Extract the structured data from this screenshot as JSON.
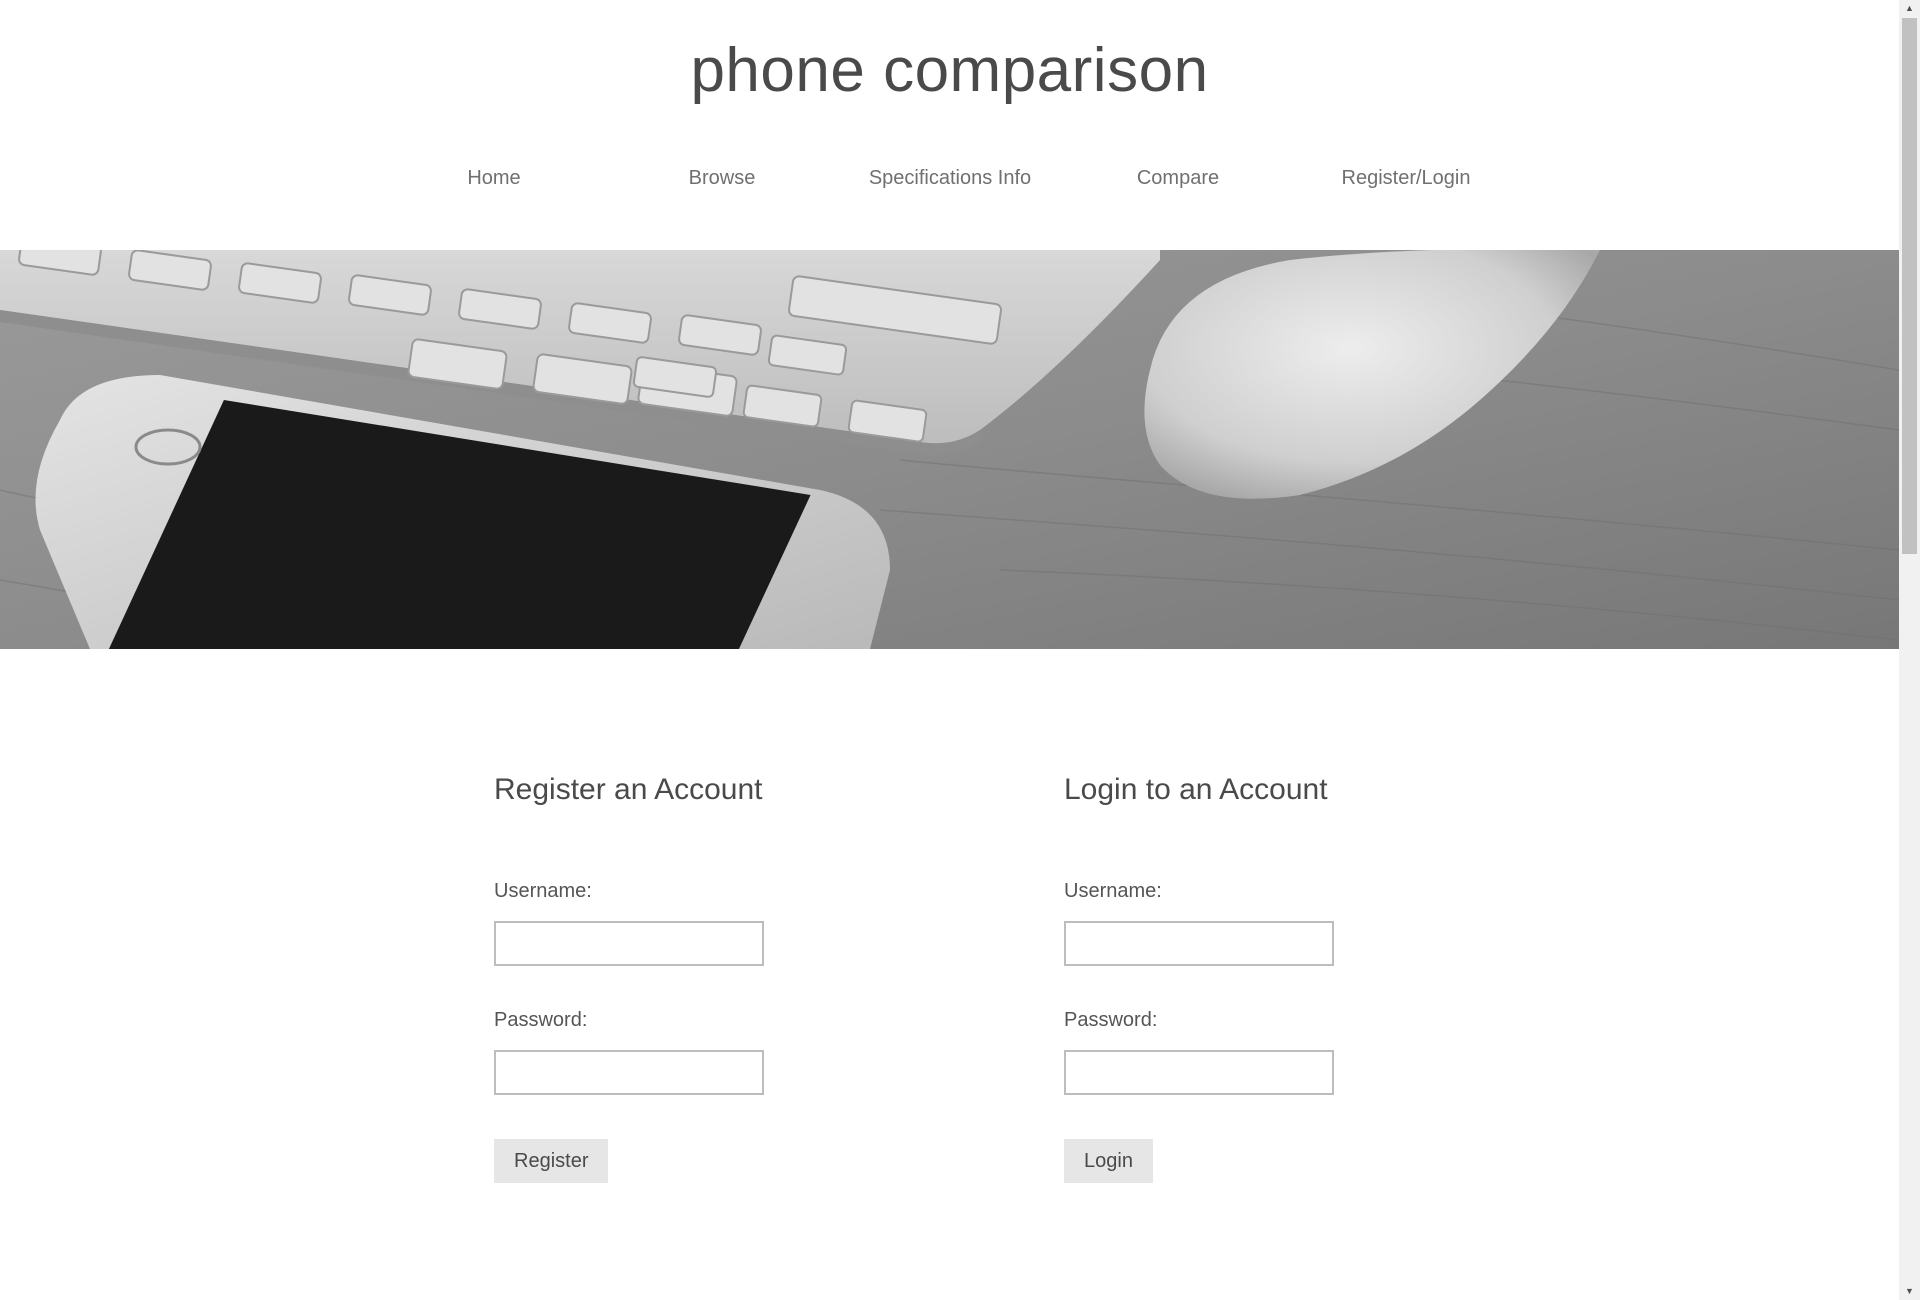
{
  "site": {
    "title": "phone comparison"
  },
  "nav": {
    "items": [
      {
        "label": "Home"
      },
      {
        "label": "Browse"
      },
      {
        "label": "Specifications Info"
      },
      {
        "label": "Compare"
      },
      {
        "label": "Register/Login"
      }
    ]
  },
  "hero": {
    "image": "desk-with-keyboard-phone-mouse"
  },
  "register": {
    "heading": "Register an Account",
    "username_label": "Username:",
    "username_value": "",
    "password_label": "Password:",
    "password_value": "",
    "button_label": "Register"
  },
  "login": {
    "heading": "Login to an Account",
    "username_label": "Username:",
    "username_value": "",
    "password_label": "Password:",
    "password_value": "",
    "button_label": "Login"
  },
  "colors": {
    "text": "#4a4a4a",
    "nav_text": "#707070",
    "input_border": "#bdbdbd",
    "button_bg": "#e6e6e6",
    "background": "#ffffff"
  }
}
